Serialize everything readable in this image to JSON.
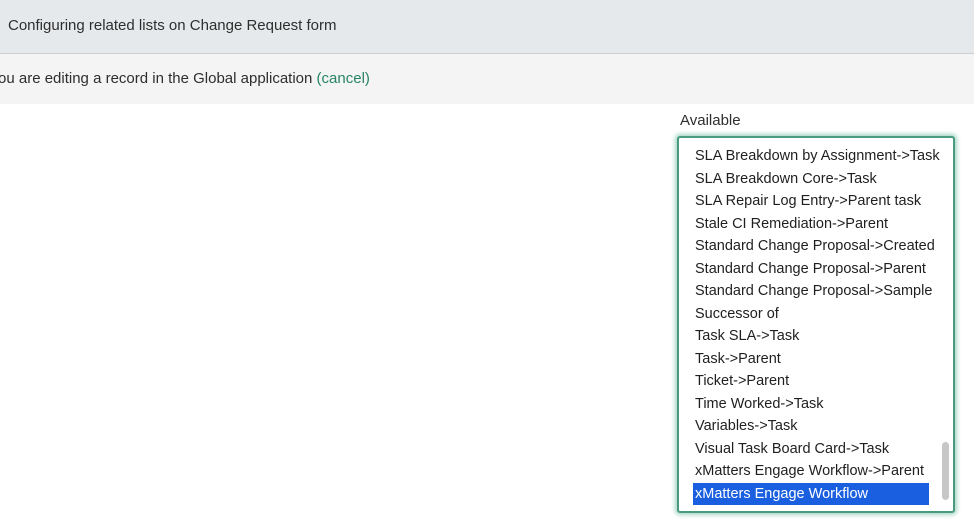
{
  "header": {
    "title": "Configuring related lists on Change Request form"
  },
  "notice": {
    "message": "ou are editing a record in the Global application ",
    "cancel_label": "(cancel)"
  },
  "available": {
    "label": "Available",
    "options": [
      "SLA Breakdown by Assignment->Task",
      "SLA Breakdown Core->Task",
      "SLA Repair Log Entry->Parent task",
      "Stale CI Remediation->Parent",
      "Standard Change Proposal->Created",
      "Standard Change Proposal->Parent",
      "Standard Change Proposal->Sample",
      "Successor of",
      "Task SLA->Task",
      "Task->Parent",
      "Ticket->Parent",
      "Time Worked->Task",
      "Variables->Task",
      "Visual Task Board Card->Task",
      "xMatters Engage Workflow->Parent",
      "xMatters Engage Workflow"
    ],
    "selected": "xMatters Engage Workflow"
  },
  "colors": {
    "accent": "#278467",
    "selection": "#1a5fe0",
    "focus_border": "#4a9a80"
  }
}
